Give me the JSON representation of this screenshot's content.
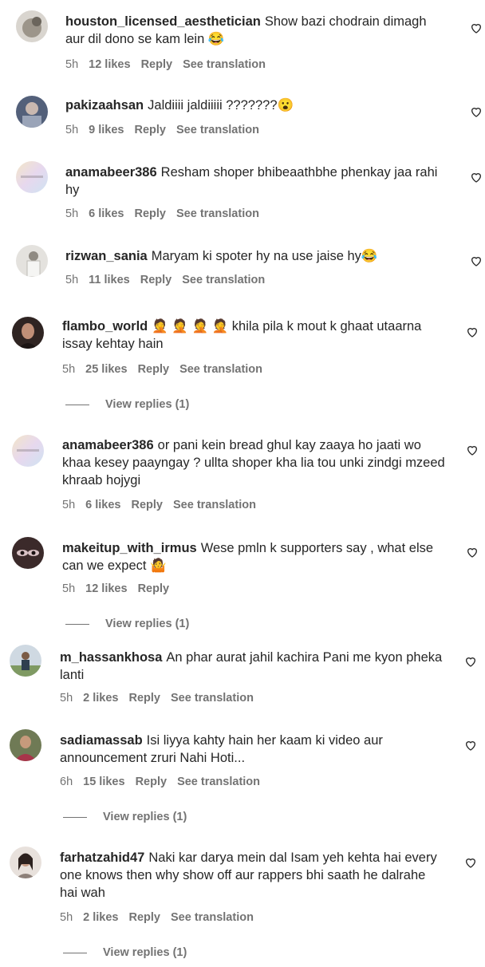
{
  "comments": [
    {
      "username": "houston_licensed_aesthetician",
      "text": "Show bazi chodrain dimagh aur dil dono se kam lein 😂",
      "time": "5h",
      "likes": "12 likes",
      "reply": "Reply",
      "translation": "See translation",
      "avatar_color": "#b9b4ac"
    },
    {
      "username": "pakizaahsan",
      "text": "Jaldiiii jaldiiiii ???????😮",
      "time": "5h",
      "likes": "9 likes",
      "reply": "Reply",
      "translation": "See translation",
      "avatar_color": "#6f7c92"
    },
    {
      "username": "anamabeer386",
      "text": "Resham shoper bhibeaathbhe phenkay jaa rahi hy",
      "time": "5h",
      "likes": "6 likes",
      "reply": "Reply",
      "translation": "See translation",
      "avatar_color": "#e9dbe4"
    },
    {
      "username": "rizwan_sania",
      "text": "Maryam ki spoter hy na use jaise hy😂",
      "time": "5h",
      "likes": "11 likes",
      "reply": "Reply",
      "translation": "See translation",
      "avatar_color": "#c7c5c2"
    },
    {
      "username": "flambo_world",
      "text": "🤦 🤦 🤦 🤦  khila pila k mout k ghaat utaarna issay kehtay hain",
      "time": "5h",
      "likes": "25 likes",
      "reply": "Reply",
      "translation": "See translation",
      "view_replies": "View replies (1)",
      "avatar_color": "#4a3a36"
    },
    {
      "username": "anamabeer386",
      "text": "or pani kein bread ghul kay zaaya ho jaati wo khaa kesey paayngay ? ullta shoper kha lia tou unki zindgi mzeed khraab hojygi",
      "time": "5h",
      "likes": "6 likes",
      "reply": "Reply",
      "translation": "See translation",
      "avatar_color": "#e9dbe4"
    },
    {
      "username": "makeitup_with_irmus",
      "text": "Wese pmln k supporters say , what else can we expect 🤷",
      "time": "5h",
      "likes": "12 likes",
      "reply": "Reply",
      "view_replies": "View replies (1)",
      "avatar_color": "#5b3f3e"
    },
    {
      "username": "m_hassankhosa",
      "text": "An phar aurat jahil kachira Pani me kyon pheka lanti",
      "time": "5h",
      "likes": "2 likes",
      "reply": "Reply",
      "translation": "See translation",
      "avatar_color": "#8a9a7b"
    },
    {
      "username": "sadiamassab",
      "text": "Isi liyya kahty hain her kaam ki video aur announcement zruri Nahi Hoti...",
      "time": "6h",
      "likes": "15 likes",
      "reply": "Reply",
      "translation": "See translation",
      "view_replies": "View replies (1)",
      "avatar_color": "#7a6e58"
    },
    {
      "username": "farhatzahid47",
      "text": "Naki kar darya mein dal Isam yeh kehta hai every one knows then why show off aur rappers bhi saath he dalrahe hai wah",
      "time": "5h",
      "likes": "2 likes",
      "reply": "Reply",
      "translation": "See translation",
      "view_replies": "View replies (1)",
      "avatar_color": "#b8a8a2"
    }
  ]
}
